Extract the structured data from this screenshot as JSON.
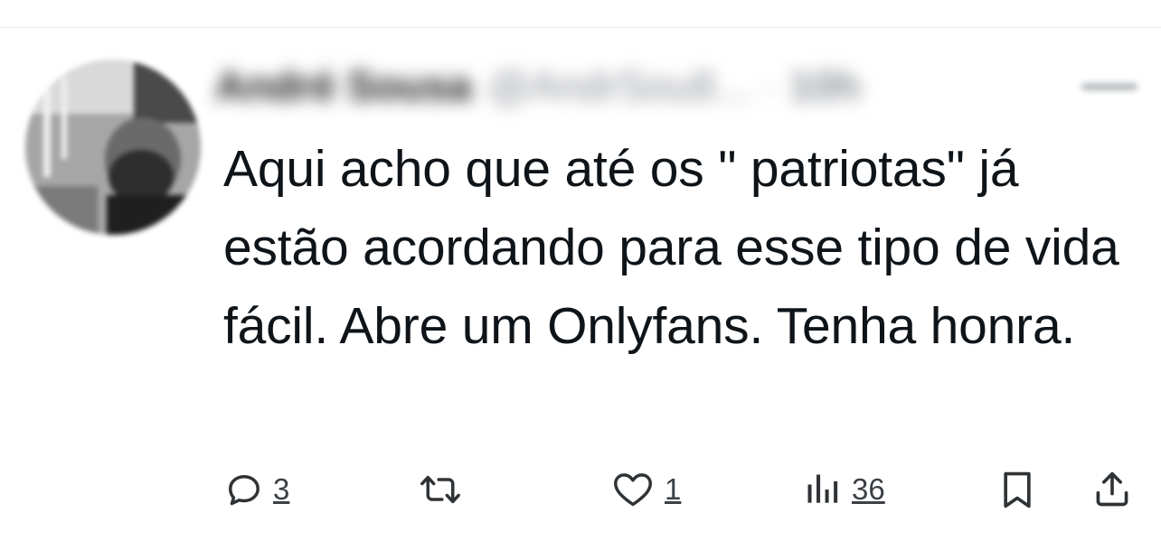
{
  "tweet": {
    "author": {
      "display_name": "André Sousa",
      "handle": "@AndrSou8...",
      "separator": "·",
      "time": "10h"
    },
    "text": "Aqui acho que até os \" patriotas\" já estão acordando para esse tipo de vida fácil. Abre um Onlyfans. Tenha honra.",
    "actions": {
      "reply": {
        "icon": "reply-icon",
        "count": "3"
      },
      "retweet": {
        "icon": "retweet-icon",
        "count": ""
      },
      "like": {
        "icon": "heart-icon",
        "count": "1"
      },
      "views": {
        "icon": "views-icon",
        "count": "36"
      },
      "bookmark": {
        "icon": "bookmark-icon"
      },
      "share": {
        "icon": "share-icon"
      }
    }
  },
  "colors": {
    "text": "#0f1419",
    "secondary": "#536471",
    "divider": "#e6ecf0"
  }
}
